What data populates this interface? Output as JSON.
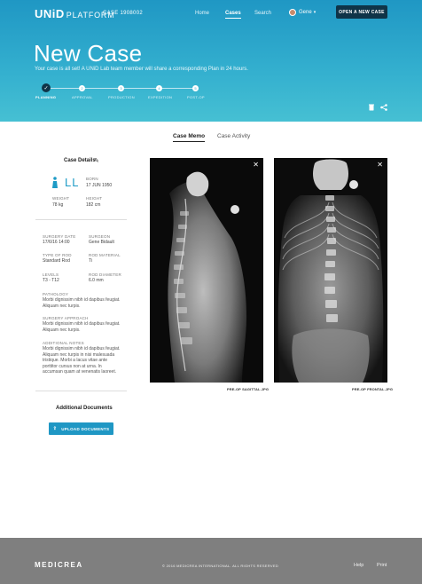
{
  "header": {
    "logo": "UNiD",
    "platform": "PLATFORM",
    "case_number": "CASE 1908002",
    "nav": {
      "home": "Home",
      "cases": "Cases",
      "search": "Search"
    },
    "user_name": "Gene",
    "new_case_button": "OPEN A NEW CASE"
  },
  "hero": {
    "title": "New Case",
    "subtitle": "Your case is all set! A UNiD Lab team member will share a corresponding Plan in 24 hours.",
    "steps": [
      {
        "label": "PLANNING",
        "number": "✓",
        "done": true
      },
      {
        "label": "APPROVAL",
        "number": "2",
        "done": false
      },
      {
        "label": "PRODUCTION",
        "number": "3",
        "done": false
      },
      {
        "label": "EXPEDITION",
        "number": "4",
        "done": false
      },
      {
        "label": "POST-OP",
        "number": "5",
        "done": false
      }
    ]
  },
  "tabs": {
    "memo": "Case Memo",
    "activity": "Case Activity"
  },
  "details": {
    "title": "Case Details",
    "initials": "LL",
    "born_label": "BORN",
    "born": "17 JUN 1950",
    "weight_label": "WEIGHT",
    "weight": "78 kg",
    "height_label": "HEIGHT",
    "height": "182 cm",
    "surgery_date_label": "SURGERY DATE",
    "surgery_date": "17/6/16 14:00",
    "surgeon_label": "SURGEON",
    "surgeon": "Gene Bidault",
    "rod_type_label": "TYPE OF ROD",
    "rod_type": "Standard Rod",
    "rod_material_label": "ROD MATERIAL",
    "rod_material": "Ti",
    "levels_label": "LEVELS",
    "levels": "T3 - T12",
    "rod_diameter_label": "ROD DIAMETER",
    "rod_diameter": "6.0 mm",
    "pathology_label": "PATHOLOGY",
    "pathology": "Morbi dignissim nibh id dapibus feugiat. Aliquam nec turpis.",
    "approach_label": "SURGERY APPROACH",
    "approach": "Morbi dignissim nibh id dapibus feugiat. Aliquam nec turpis.",
    "notes_label": "ADDITIONAL NOTES",
    "notes": "Morbi dignissim nibh id dapibus feugiat. Aliquam nec turpis in nisi malesuada tristique. Morbi a lacus vitae ante porttitor cursus non at urna. In accumsan quam at venenatis laoreet."
  },
  "additional_documents": {
    "title": "Additional Documents",
    "upload_button": "UPLOAD DOCUMENTS"
  },
  "images": [
    {
      "caption": "PRE-OP SAGITTAL.JPG"
    },
    {
      "caption": "PRE-OP FRONTAL.JPG"
    }
  ],
  "footer": {
    "logo": "MEDICREA",
    "copyright": "© 2016 MEDICREA INTERNATIONAL. ALL RIGHTS RESERVED",
    "help": "Help",
    "print": "Print"
  }
}
